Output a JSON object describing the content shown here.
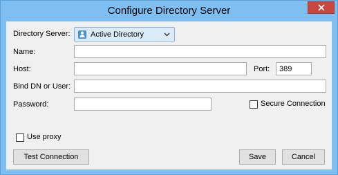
{
  "window": {
    "title": "Configure Directory Server"
  },
  "form": {
    "directory_server_label": "Directory Server:",
    "directory_server_value": "Active Directory",
    "name_label": "Name:",
    "name_value": "",
    "host_label": "Host:",
    "host_value": "",
    "port_label": "Port:",
    "port_value": "389",
    "bind_label": "Bind DN or User:",
    "bind_value": "",
    "password_label": "Password:",
    "password_value": "",
    "secure_connection_label": "Secure Connection",
    "secure_connection_checked": false,
    "use_proxy_label": "Use proxy",
    "use_proxy_checked": false
  },
  "buttons": {
    "test_connection": "Test Connection",
    "save": "Save",
    "cancel": "Cancel"
  },
  "icons": {
    "close": "close-icon",
    "directory": "directory-user-icon",
    "dropdown": "chevron-down-icon"
  },
  "colors": {
    "title_bar": "#7fbef0",
    "close_button": "#c9483d",
    "dropdown_bg": "#dcebf8"
  }
}
